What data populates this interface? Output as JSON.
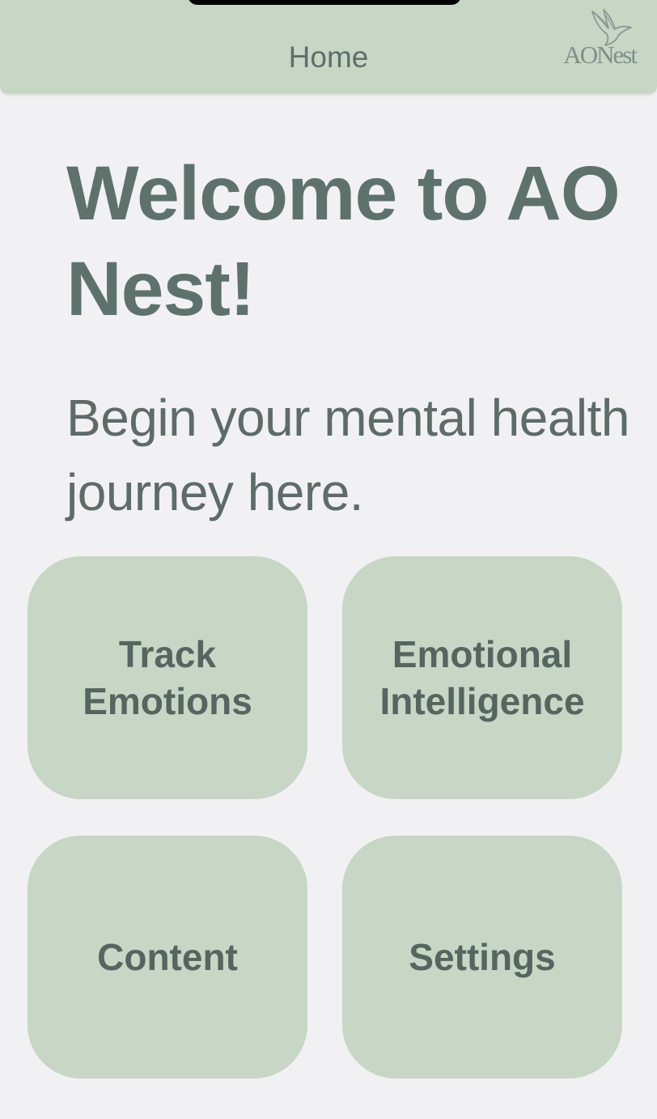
{
  "nav": {
    "title": "Home",
    "logo_text": "AONest"
  },
  "welcome": {
    "heading": "Welcome to AO Nest!",
    "subtitle": "Begin your mental health journey here."
  },
  "tiles": [
    {
      "label": "Track\nEmotions"
    },
    {
      "label": "Emotional\nIntelligence"
    },
    {
      "label": "Content"
    },
    {
      "label": "Settings"
    }
  ],
  "colors": {
    "background": "#f1f1f3",
    "accent_green": "#c7d6c5",
    "heading_text": "#5e726b",
    "body_text": "#5f6b66"
  },
  "icons": {
    "logo": "bird-icon"
  }
}
